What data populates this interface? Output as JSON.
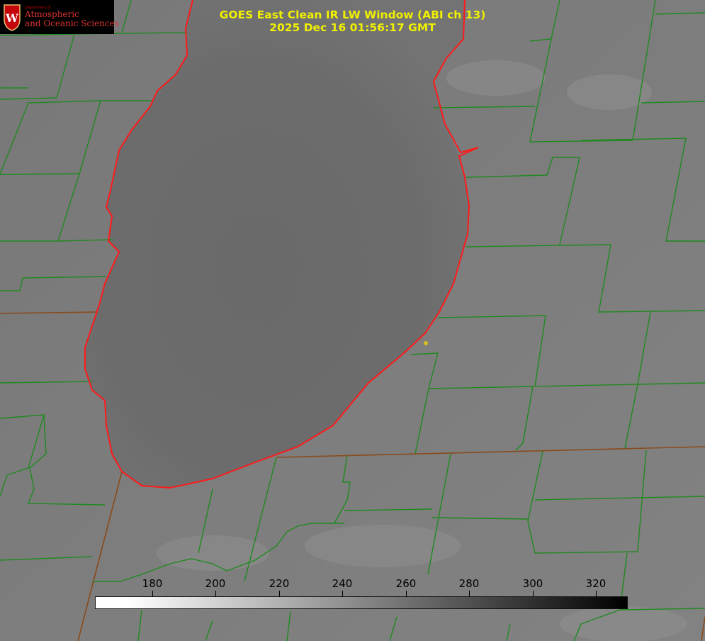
{
  "title": {
    "line1": "GOES East Clean IR LW Window (ABI ch 13)",
    "line2": "2025 Dec 16 01:56:17 GMT"
  },
  "logo": {
    "dept": "Department of",
    "line1": "Atmospheric",
    "line2": "and Oceanic Sciences",
    "letter": "W"
  },
  "colorbar": {
    "ticks": [
      "180",
      "200",
      "220",
      "240",
      "260",
      "280",
      "300",
      "320"
    ],
    "colors": {
      "low": "#ffffff",
      "high": "#000000"
    }
  },
  "colors": {
    "county_lines": "#1f8a1f",
    "shoreline": "#ff1a1a",
    "state_lines": "#8a4a1a",
    "title": "#f0f000",
    "marker": "#d8c020"
  }
}
